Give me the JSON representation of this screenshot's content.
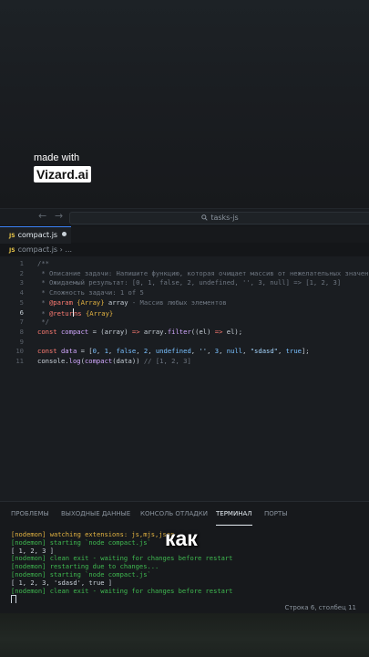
{
  "watermark": {
    "line1": "made with",
    "line2": "Vizard.ai"
  },
  "titlebar": {
    "back_arrow": "←",
    "forward_arrow": "→",
    "search_text": "tasks-js"
  },
  "tab": {
    "badge": "JS",
    "filename": "compact.js"
  },
  "breadcrumb": {
    "badge": "JS",
    "path": "compact.js",
    "sep": "›",
    "more": "..."
  },
  "editor": {
    "active_line": 6,
    "lines": [
      {
        "n": "1",
        "tokens": [
          {
            "c": "c-comment",
            "t": "/**"
          }
        ]
      },
      {
        "n": "2",
        "tokens": [
          {
            "c": "c-comment",
            "t": " * Описание задачи: Напишите функцию, которая очищает массив от нежелательных значений"
          }
        ]
      },
      {
        "n": "3",
        "tokens": [
          {
            "c": "c-comment",
            "t": " * Ожидаемый результат: [0, 1, false, 2, undefined, '', 3, null] => [1, 2, 3]"
          }
        ]
      },
      {
        "n": "4",
        "tokens": [
          {
            "c": "c-comment",
            "t": " * Сложность задачи: 1 of 5"
          }
        ]
      },
      {
        "n": "5",
        "tokens": [
          {
            "c": "c-comment",
            "t": " * "
          },
          {
            "c": "c-tag",
            "t": "@param"
          },
          {
            "c": "c-comment",
            "t": " "
          },
          {
            "c": "c-type",
            "t": "{Array}"
          },
          {
            "c": "c-plain",
            "t": " array"
          },
          {
            "c": "c-comment",
            "t": " - Массив любых элементов"
          }
        ]
      },
      {
        "n": "6",
        "tokens": [
          {
            "c": "c-comment",
            "t": " * "
          },
          {
            "c": "c-tag",
            "t": "@retur"
          },
          {
            "c": "cursor",
            "t": ""
          },
          {
            "c": "c-tag",
            "t": "ns"
          },
          {
            "c": "c-comment",
            "t": " "
          },
          {
            "c": "c-type",
            "t": "{Array}"
          }
        ]
      },
      {
        "n": "7",
        "tokens": [
          {
            "c": "c-comment",
            "t": " */"
          }
        ]
      },
      {
        "n": "8",
        "tokens": [
          {
            "c": "c-kw",
            "t": "const"
          },
          {
            "c": "c-plain",
            "t": " "
          },
          {
            "c": "c-var",
            "t": "compact"
          },
          {
            "c": "c-plain",
            "t": " = (array) "
          },
          {
            "c": "c-kw",
            "t": "=>"
          },
          {
            "c": "c-plain",
            "t": " array."
          },
          {
            "c": "c-fn",
            "t": "filter"
          },
          {
            "c": "c-plain",
            "t": "((el) "
          },
          {
            "c": "c-kw",
            "t": "=>"
          },
          {
            "c": "c-plain",
            "t": " el);"
          }
        ]
      },
      {
        "n": "9",
        "tokens": []
      },
      {
        "n": "10",
        "tokens": [
          {
            "c": "c-kw",
            "t": "const"
          },
          {
            "c": "c-plain",
            "t": " "
          },
          {
            "c": "c-var",
            "t": "data"
          },
          {
            "c": "c-plain",
            "t": " = ["
          },
          {
            "c": "c-num",
            "t": "0"
          },
          {
            "c": "c-plain",
            "t": ", "
          },
          {
            "c": "c-num",
            "t": "1"
          },
          {
            "c": "c-plain",
            "t": ", "
          },
          {
            "c": "c-num",
            "t": "false"
          },
          {
            "c": "c-plain",
            "t": ", "
          },
          {
            "c": "c-num",
            "t": "2"
          },
          {
            "c": "c-plain",
            "t": ", "
          },
          {
            "c": "c-num",
            "t": "undefined"
          },
          {
            "c": "c-plain",
            "t": ", "
          },
          {
            "c": "c-str",
            "t": "''"
          },
          {
            "c": "c-plain",
            "t": ", "
          },
          {
            "c": "c-num",
            "t": "3"
          },
          {
            "c": "c-plain",
            "t": ", "
          },
          {
            "c": "c-num",
            "t": "null"
          },
          {
            "c": "c-plain",
            "t": ", "
          },
          {
            "c": "c-str",
            "t": "\"sdasd\""
          },
          {
            "c": "c-plain",
            "t": ", "
          },
          {
            "c": "c-num",
            "t": "true"
          },
          {
            "c": "c-plain",
            "t": "];"
          }
        ]
      },
      {
        "n": "11",
        "tokens": [
          {
            "c": "c-plain",
            "t": "console."
          },
          {
            "c": "c-fn",
            "t": "log"
          },
          {
            "c": "c-plain",
            "t": "("
          },
          {
            "c": "c-fn",
            "t": "compact"
          },
          {
            "c": "c-plain",
            "t": "(data)) "
          },
          {
            "c": "c-comment",
            "t": "// [1, 2, 3]"
          }
        ]
      }
    ]
  },
  "panel": {
    "tabs": [
      {
        "label": "ПРОБЛЕМЫ",
        "active": false
      },
      {
        "label": "ВЫХОДНЫЕ ДАННЫЕ",
        "active": false
      },
      {
        "label": "КОНСОЛЬ ОТЛАДКИ",
        "active": false
      },
      {
        "label": "ТЕРМИНАЛ",
        "active": true
      },
      {
        "label": "ПОРТЫ",
        "active": false
      }
    ],
    "terminal_lines": [
      {
        "c": "t-yellow",
        "t": "[nodemon] watching extensions: js,mjs,json"
      },
      {
        "c": "t-green",
        "t": "[nodemon] starting `node compact.js`"
      },
      {
        "c": "t-plain",
        "t": "[ 1, 2, 3 ]"
      },
      {
        "c": "t-green",
        "t": "[nodemon] clean exit - waiting for changes before restart"
      },
      {
        "c": "t-green",
        "t": "[nodemon] restarting due to changes..."
      },
      {
        "c": "t-green",
        "t": "[nodemon] starting `node compact.js`"
      },
      {
        "c": "t-plain",
        "t": "[ 1, 2, 3, 'sdasd', true ]"
      },
      {
        "c": "t-green",
        "t": "[nodemon] clean exit - waiting for changes before restart"
      }
    ]
  },
  "subtitle": "как",
  "statusbar": {
    "position": "Строка 6, столбец 11"
  },
  "colors": {
    "accent": "#3b82f6",
    "background": "#1a1d21",
    "keyword": "#ff7b72",
    "string": "#a5d6ff",
    "terminal_green": "#3fb950",
    "terminal_yellow": "#e3b341"
  }
}
